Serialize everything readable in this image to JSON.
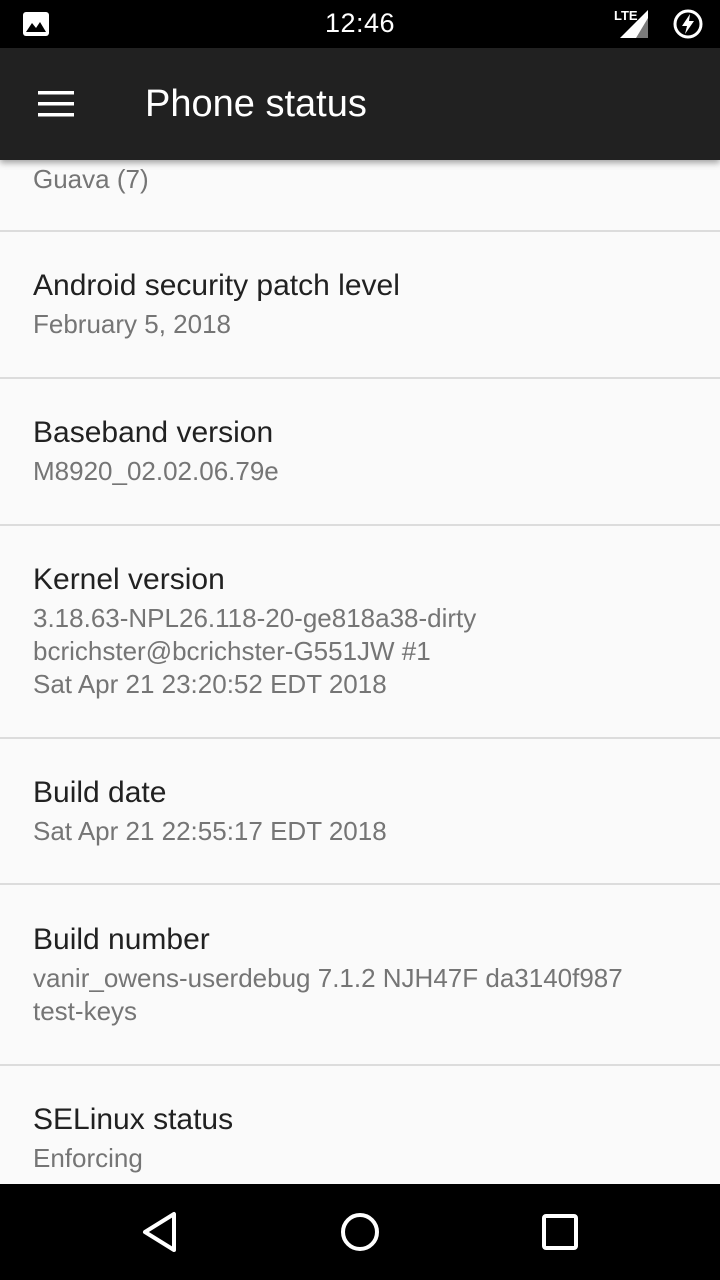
{
  "status_bar": {
    "time": "12:46",
    "left_icon": "image-notification-icon",
    "network_label": "LTE",
    "battery_icon": "battery-charging-icon"
  },
  "toolbar": {
    "menu_icon": "menu-icon",
    "title": "Phone status"
  },
  "items": [
    {
      "title": "",
      "summary": "Guava (7)"
    },
    {
      "title": "Android security patch level",
      "summary": "February 5, 2018"
    },
    {
      "title": "Baseband version",
      "summary": "M8920_02.02.06.79e"
    },
    {
      "title": "Kernel version",
      "summary": "3.18.63-NPL26.118-20-ge818a38-dirty\nbcrichster@bcrichster-G551JW #1\nSat Apr 21 23:20:52 EDT 2018"
    },
    {
      "title": "Build date",
      "summary": "Sat Apr 21 22:55:17 EDT 2018"
    },
    {
      "title": "Build number",
      "summary": "vanir_owens-userdebug 7.1.2 NJH47F da3140f987\ntest-keys"
    },
    {
      "title": "SELinux status",
      "summary": "Enforcing"
    }
  ],
  "nav_bar": {
    "back_icon": "back-icon",
    "home_icon": "home-icon",
    "recents_icon": "recents-icon"
  },
  "colors": {
    "status_bar": "#000000",
    "toolbar": "#212121",
    "background": "#fafafa",
    "title_text": "#212121",
    "summary_text": "#757575",
    "divider": "#dcdcdc"
  }
}
